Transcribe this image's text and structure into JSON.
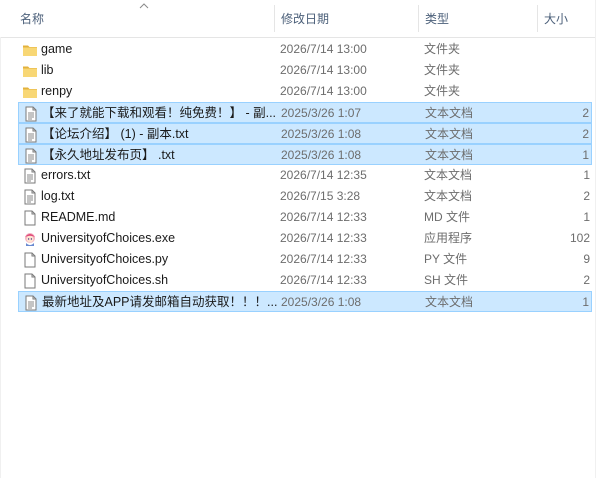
{
  "columns": {
    "name": "名称",
    "date": "修改日期",
    "type": "类型",
    "size": "大小"
  },
  "colors": {
    "folder": "#f8d775",
    "folder_dark": "#e3b23c",
    "selection_bg": "#cce8ff",
    "selection_border": "#99d1ff",
    "header_text": "#4c607a"
  },
  "files": [
    {
      "name": "game",
      "date": "2026/7/14 13:00",
      "type": "文件夹",
      "size": "",
      "icon": "folder-icon",
      "selected": false
    },
    {
      "name": "lib",
      "date": "2026/7/14 13:00",
      "type": "文件夹",
      "size": "",
      "icon": "folder-icon",
      "selected": false
    },
    {
      "name": "renpy",
      "date": "2026/7/14 13:00",
      "type": "文件夹",
      "size": "",
      "icon": "folder-icon",
      "selected": false
    },
    {
      "name": "【来了就能下载和观看！纯免费！】 - 副...",
      "date": "2025/3/26 1:07",
      "type": "文本文档",
      "size": "2",
      "icon": "text-file-icon",
      "selected": true
    },
    {
      "name": "【论坛介绍】 (1) - 副本.txt",
      "date": "2025/3/26 1:08",
      "type": "文本文档",
      "size": "2",
      "icon": "text-file-icon",
      "selected": true
    },
    {
      "name": "【永久地址发布页】 .txt",
      "date": "2025/3/26 1:08",
      "type": "文本文档",
      "size": "1",
      "icon": "text-file-icon",
      "selected": true
    },
    {
      "name": "errors.txt",
      "date": "2026/7/14 12:35",
      "type": "文本文档",
      "size": "1",
      "icon": "text-file-icon",
      "selected": false
    },
    {
      "name": "log.txt",
      "date": "2026/7/15 3:28",
      "type": "文本文档",
      "size": "2",
      "icon": "text-file-icon",
      "selected": false
    },
    {
      "name": "README.md",
      "date": "2026/7/14 12:33",
      "type": "MD 文件",
      "size": "1",
      "icon": "blank-file-icon",
      "selected": false
    },
    {
      "name": "UniversityofChoices.exe",
      "date": "2026/7/14 12:33",
      "type": "应用程序",
      "size": "102",
      "icon": "app-icon",
      "selected": false
    },
    {
      "name": "UniversityofChoices.py",
      "date": "2026/7/14 12:33",
      "type": "PY 文件",
      "size": "9",
      "icon": "blank-file-icon",
      "selected": false
    },
    {
      "name": "UniversityofChoices.sh",
      "date": "2026/7/14 12:33",
      "type": "SH 文件",
      "size": "2",
      "icon": "blank-file-icon",
      "selected": false
    },
    {
      "name": "最新地址及APP请发邮箱自动获取！！！...",
      "date": "2025/3/26 1:08",
      "type": "文本文档",
      "size": "1",
      "icon": "text-file-icon",
      "selected": true
    }
  ]
}
